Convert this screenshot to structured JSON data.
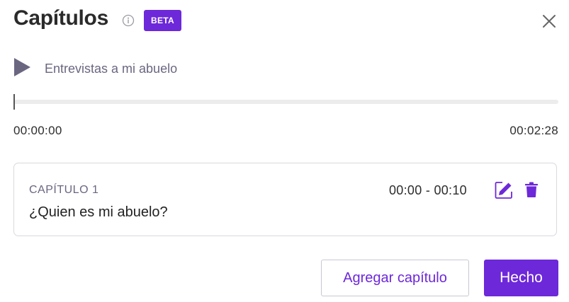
{
  "header": {
    "title": "Capítulos",
    "badge": "BETA",
    "info_icon": "info-circle-icon",
    "close_icon": "close-icon"
  },
  "player": {
    "play_icon": "play-icon",
    "track_title": "Entrevistas a mi abuelo",
    "current_time": "00:00:00",
    "total_time": "00:02:28",
    "progress": 0
  },
  "chapters": [
    {
      "label": "CAPÍTULO 1",
      "title": "¿Quien es mi abuelo?",
      "range": "00:00 - 00:10"
    }
  ],
  "actions": {
    "add_chapter_label": "Agregar capítulo",
    "done_label": "Hecho"
  },
  "colors": {
    "accent": "#6d28d9",
    "muted_text": "#6b6680",
    "border": "#d9d9e0"
  }
}
